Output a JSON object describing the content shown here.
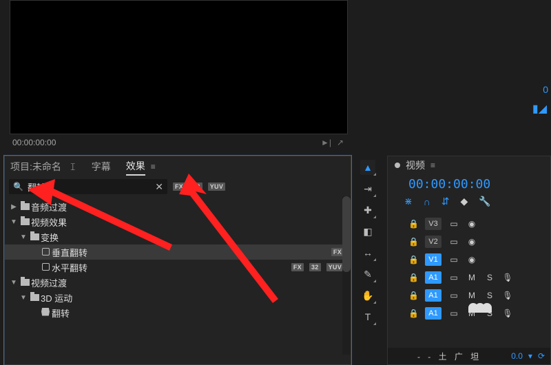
{
  "monitor": {
    "timecode": "00:00:00:00",
    "play_icon": "►|",
    "export_icon": "↗"
  },
  "right_indicator": {
    "zero": "0",
    "marker": "▮◢"
  },
  "panel": {
    "tabs": {
      "project": "项目:未命名",
      "subtitle": "字幕",
      "effects": "效果"
    },
    "menu_glyph": "≡",
    "caret_glyph": "𝙸",
    "search": {
      "placeholder": "",
      "value": "翻转",
      "mag": "🔍",
      "clear": "✕"
    },
    "badges": {
      "fx": "FX",
      "num": "32",
      "yuv": "YUV"
    },
    "tree": [
      {
        "indent": 1,
        "twisty": "▶",
        "icon": "folder",
        "label": "音频过渡"
      },
      {
        "indent": 1,
        "twisty": "▼",
        "icon": "folder",
        "label": "视频效果"
      },
      {
        "indent": 2,
        "twisty": "▼",
        "icon": "folder",
        "label": "变换"
      },
      {
        "indent": 3,
        "twisty": "",
        "icon": "preset",
        "label": "垂直翻转",
        "selected": true,
        "tags": [
          "fx"
        ]
      },
      {
        "indent": 3,
        "twisty": "",
        "icon": "preset",
        "label": "水平翻转",
        "tags": [
          "fx",
          "num",
          "yuv"
        ]
      },
      {
        "indent": 1,
        "twisty": "▼",
        "icon": "folder",
        "label": "视频过渡"
      },
      {
        "indent": 2,
        "twisty": "▼",
        "icon": "folder",
        "label": "3D 运动"
      },
      {
        "indent": 3,
        "twisty": "",
        "icon": "fx",
        "label": "翻转"
      }
    ]
  },
  "tools": [
    {
      "name": "selection-tool",
      "glyph": "▲",
      "active": true,
      "sub": true
    },
    {
      "name": "track-select-tool",
      "glyph": "⇥",
      "sub": true
    },
    {
      "name": "ripple-edit-tool",
      "glyph": "✚",
      "sub": true
    },
    {
      "name": "razor-tool",
      "glyph": "◧"
    },
    {
      "name": "slip-tool",
      "glyph": "↔",
      "sub": true
    },
    {
      "name": "pen-tool",
      "glyph": "✎",
      "sub": true
    },
    {
      "name": "hand-tool",
      "glyph": "✋",
      "sub": true
    },
    {
      "name": "type-tool",
      "glyph": "T",
      "sub": true
    }
  ],
  "timeline": {
    "title": "视频",
    "menu_glyph": "≡",
    "timecode": "00:00:00:00",
    "icons": {
      "snap": "⋇",
      "magnet": "∩",
      "linked": "⇵",
      "marker": "◆",
      "wrench": "🔧"
    },
    "tracks": [
      {
        "lock": "🔒",
        "label": "V3",
        "on": false,
        "a": "▭",
        "b": "◉"
      },
      {
        "lock": "🔒",
        "label": "V2",
        "on": false,
        "a": "▭",
        "b": "◉"
      },
      {
        "lock": "🔒",
        "label": "V1",
        "on": true,
        "a": "▭",
        "b": "◉"
      },
      {
        "lock": "🔒",
        "label": "A1",
        "on": true,
        "a": "▭",
        "b": "M",
        "c": "S",
        "d": "🎙"
      },
      {
        "lock": "🔒",
        "label": "A1",
        "on": true,
        "a": "▭",
        "b": "M",
        "c": "S",
        "d": "🎙"
      },
      {
        "lock": "🔒",
        "label": "A1",
        "on": true,
        "a": "▭",
        "b": "M",
        "c": "S",
        "d": "🎙"
      }
    ],
    "footer": {
      "label": "- - 土 广 坦",
      "value": "0.0",
      "btn1": "▾",
      "btn2": "⟳"
    }
  }
}
